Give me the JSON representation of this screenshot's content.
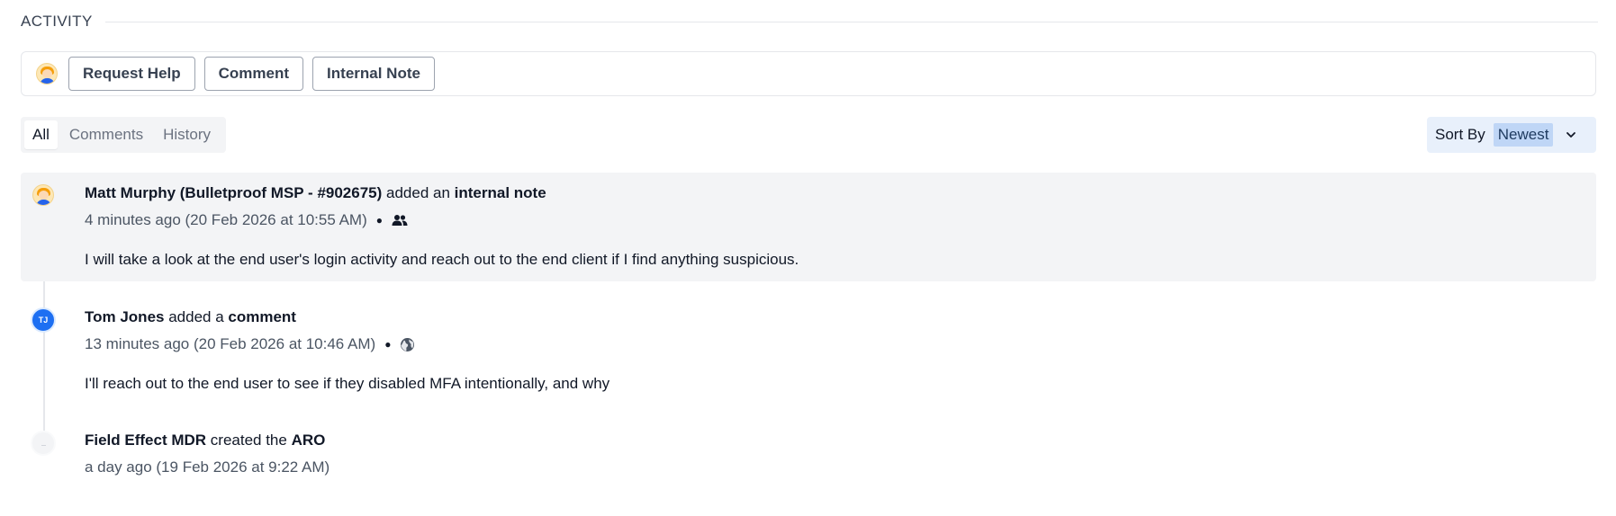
{
  "section": {
    "title": "ACTIVITY"
  },
  "actions": {
    "request_help": "Request Help",
    "comment": "Comment",
    "internal_note": "Internal Note"
  },
  "filters": {
    "tabs": [
      {
        "label": "All",
        "active": true
      },
      {
        "label": "Comments",
        "active": false
      },
      {
        "label": "History",
        "active": false
      }
    ]
  },
  "sort": {
    "label": "Sort By",
    "value": "Newest",
    "icon": "chevron-down-icon"
  },
  "entries": [
    {
      "author": "Matt Murphy (Bulletproof MSP - #902675)",
      "action": " added an ",
      "object": "internal note",
      "time": "4 minutes ago (20 Feb 2026 at 10:55 AM)",
      "visibility_icon": "people-icon",
      "text": "I will take a look at the end user's login activity and reach out to the end client if I find anything suspicious."
    },
    {
      "author": "Tom Jones",
      "initials": "TJ",
      "action": " added a ",
      "object": "comment",
      "time": "13 minutes ago (20 Feb 2026 at 10:46 AM)",
      "visibility_icon": "globe-icon",
      "text": "I'll reach out to the end user to see if they disabled MFA intentionally, and why"
    },
    {
      "author": "Field Effect MDR",
      "action": " created the ",
      "object": "ARO",
      "time": "a day ago (19 Feb 2026 at 9:22 AM)"
    }
  ]
}
